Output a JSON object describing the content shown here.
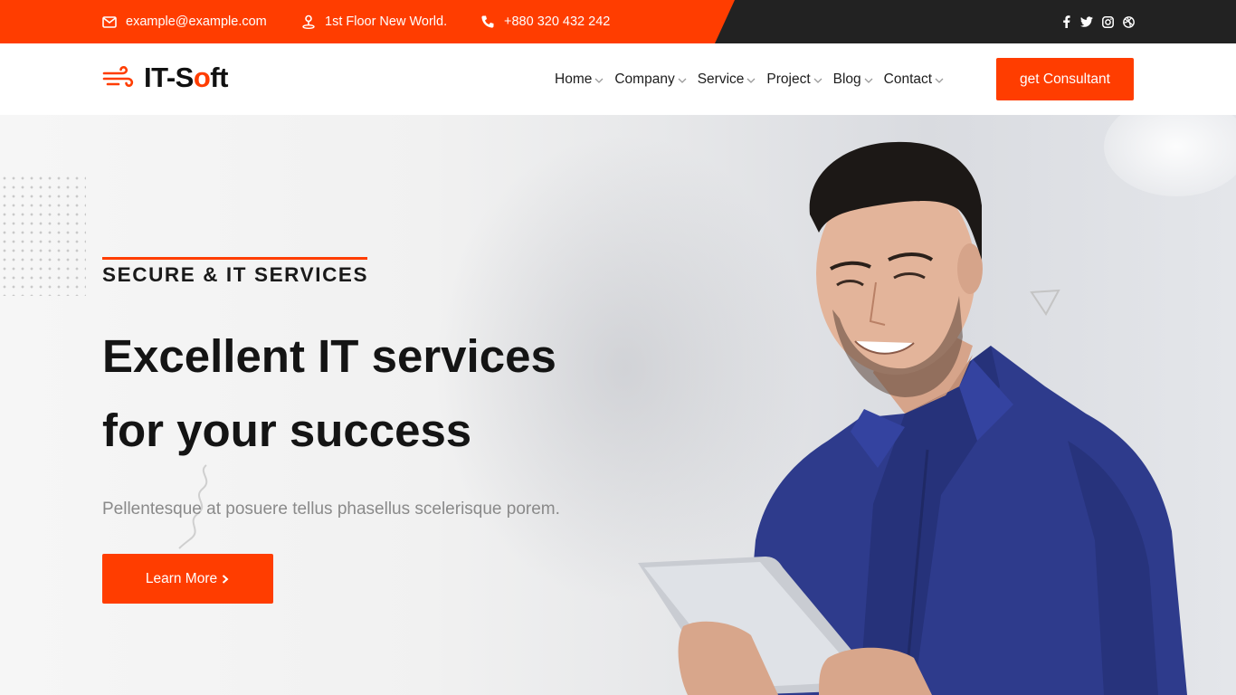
{
  "topbar": {
    "email": "example@example.com",
    "address": "1st Floor New World.",
    "phone": "+880 320 432 242",
    "social_icons": [
      "facebook-icon",
      "twitter-icon",
      "instagram-icon",
      "dribbble-icon"
    ]
  },
  "header": {
    "logo_part1": "IT-S",
    "logo_part2": "o",
    "logo_part3": "ft",
    "nav": [
      "Home",
      "Company",
      "Service",
      "Project",
      "Blog",
      "Contact"
    ],
    "cta_label": "get Consultant"
  },
  "hero": {
    "kicker": "SECURE & IT SERVICES",
    "headline_line1": "Excellent IT services",
    "headline_line2": "for your success",
    "description": "Pellentesque at posuere tellus phasellus scelerisque porem.",
    "button_label": "Learn More",
    "button_icon": "chevron-right-icon"
  },
  "colors": {
    "accent": "#ff3d00",
    "dark": "#222222",
    "text": "#141414",
    "muted": "#8a8a8a"
  }
}
